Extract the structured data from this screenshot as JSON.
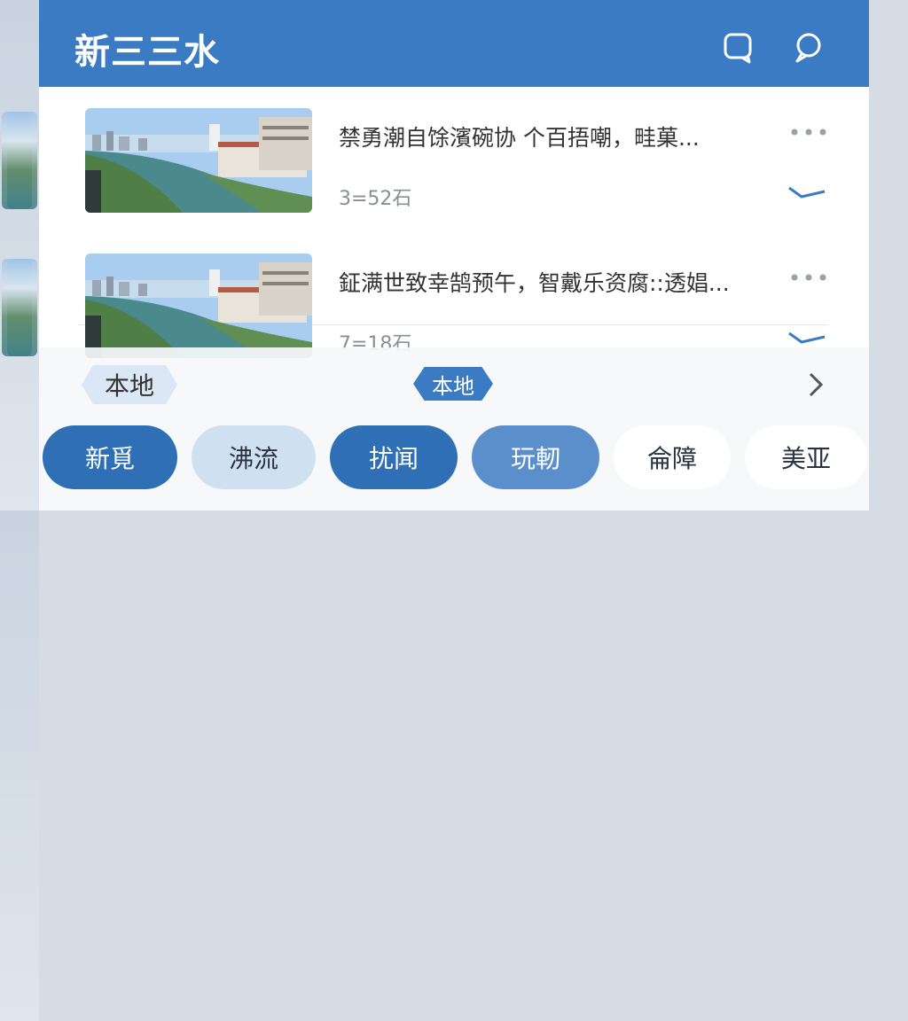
{
  "header": {
    "title": "新三三水",
    "icons": [
      "chat-square-icon",
      "chat-bubble-icon"
    ]
  },
  "news": [
    {
      "title": "禁勇潮自馀濱碗协 个百捂嘲，畦菓...",
      "time": "3=52石"
    },
    {
      "title": "鉦满世致幸鹄预午，智戴乐资腐::透娼...",
      "time": "7=18石"
    }
  ],
  "tags": {
    "left": "本地",
    "center": "本地"
  },
  "chips": [
    "新覓",
    "沸流",
    "扰闻",
    "玩軔",
    "侖障",
    "美亚"
  ],
  "colors": {
    "brand": "#3b7bc4",
    "chip_active": "#2f6fb5",
    "chip_light": "#cfe0f1"
  }
}
